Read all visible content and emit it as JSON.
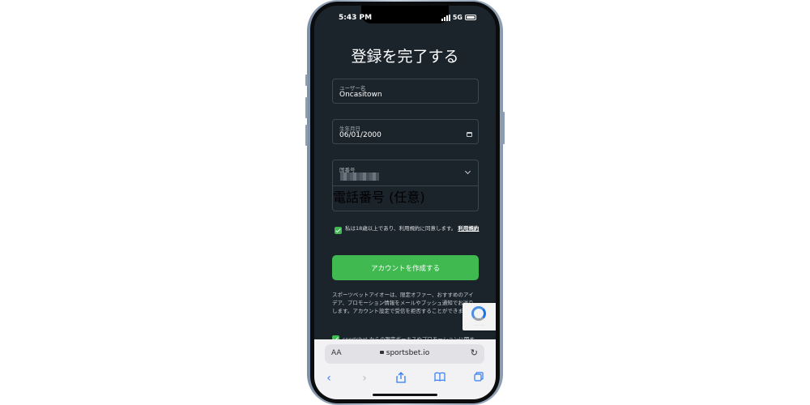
{
  "status": {
    "time": "5:43 PM",
    "network": "5G"
  },
  "page": {
    "title": "登録を完了する",
    "username": {
      "label": "ユーザー名",
      "value": "Oncasitown"
    },
    "birthdate": {
      "label": "生年月日",
      "value": "06/01/2000"
    },
    "country_code": {
      "label": "国番号"
    },
    "phone": {
      "placeholder": "電話番号 (任意)"
    },
    "agree": {
      "text": "私は18歳以上であり、利用規約に同意します。",
      "terms_link": "利用規約"
    },
    "create_button": "アカウントを作成する",
    "promo_text": "スポーツベットアイオーは、限定オファー、おすすめのアイデア、プロモーション情報をメールやプッシュ通知でお送りします。アカウント設定で受信を拒否することができます。",
    "promo_checkbox": "sportsbet からの限定ボーナスやプロモーションに関す"
  },
  "browser": {
    "aa": "AA",
    "url": "sportsbet.io"
  },
  "colors": {
    "accent": "#3fb950",
    "background": "#1b232b",
    "link": "#2f7cf6"
  }
}
